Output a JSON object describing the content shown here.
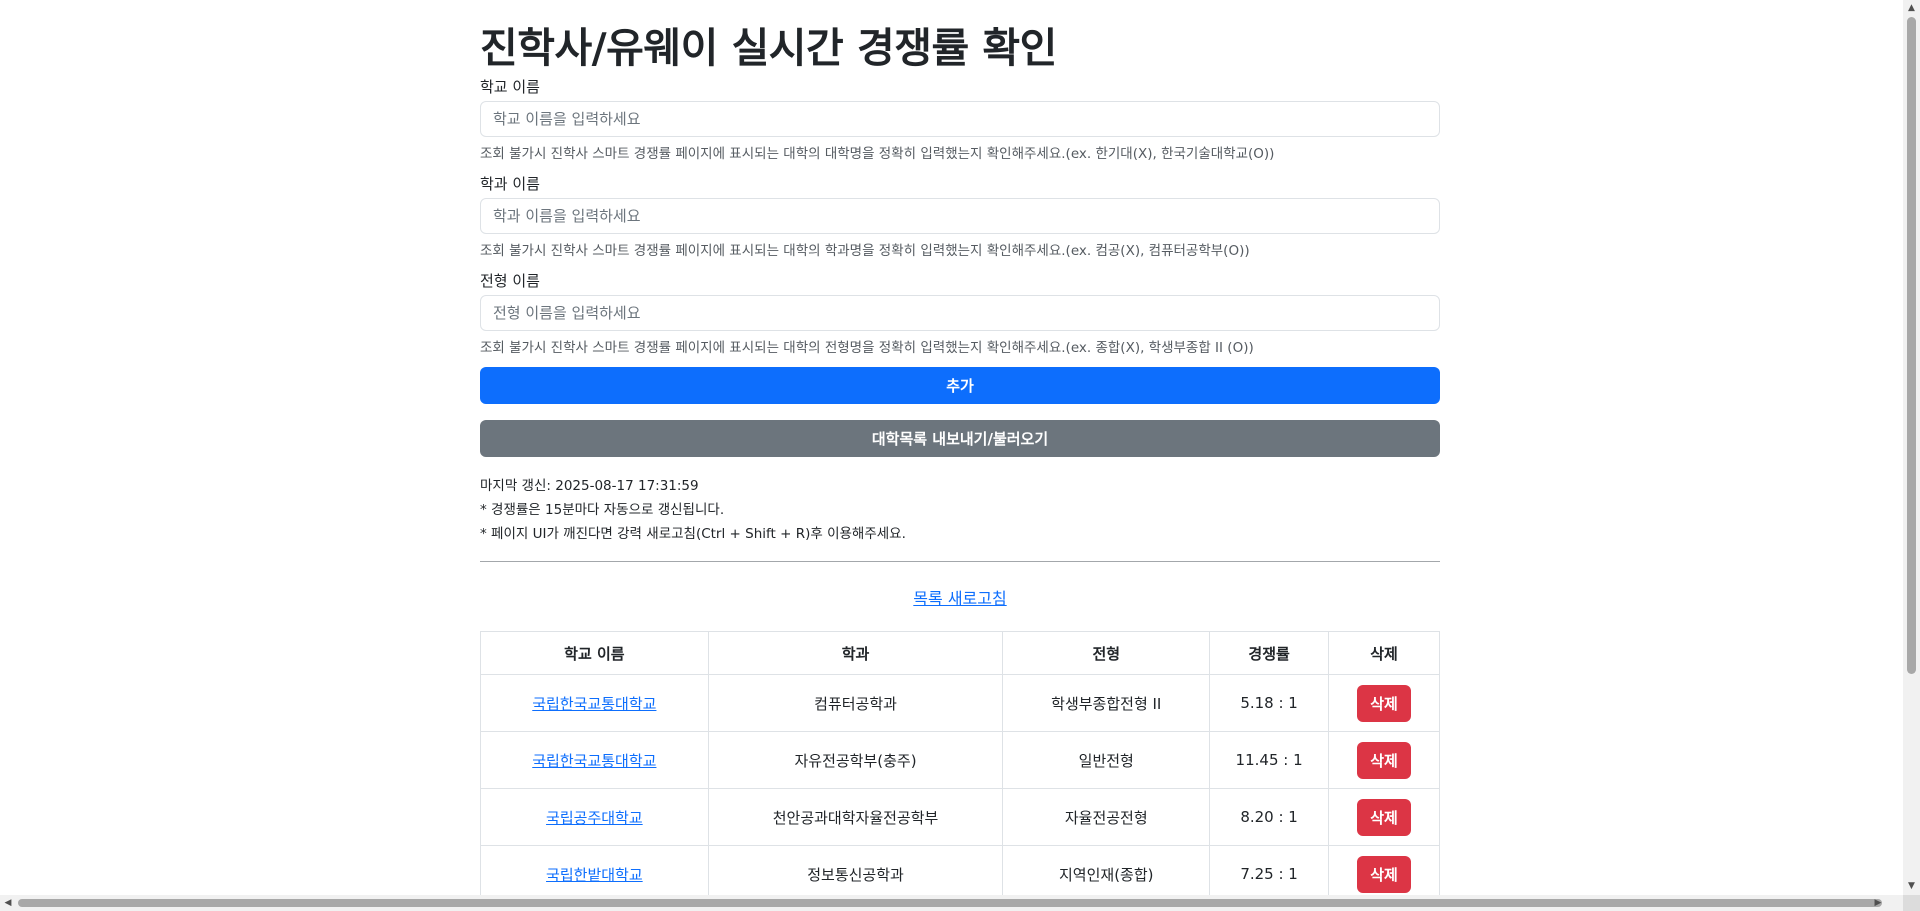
{
  "title": "진학사/유웨이 실시간 경쟁률 확인",
  "school": {
    "label": "학교 이름",
    "placeholder": "학교 이름을 입력하세요",
    "help": "조회 불가시 진학사 스마트 경쟁률 페이지에 표시되는 대학의 대학명을 정확히 입력했는지 확인해주세요.(ex. 한기대(X), 한국기술대학교(O))"
  },
  "department": {
    "label": "학과 이름",
    "placeholder": "학과 이름을 입력하세요",
    "help": "조회 불가시 진학사 스마트 경쟁률 페이지에 표시되는 대학의 학과명을 정확히 입력했는지 확인해주세요.(ex. 컴공(X), 컴퓨터공학부(O))"
  },
  "admission": {
    "label": "전형 이름",
    "placeholder": "전형 이름을 입력하세요",
    "help": "조회 불가시 진학사 스마트 경쟁률 페이지에 표시되는 대학의 전형명을 정확히 입력했는지 확인해주세요.(ex. 종합(X), 학생부종합 II (O))"
  },
  "buttons": {
    "add": "추가",
    "export_import": "대학목록 내보내기/불러오기"
  },
  "info": {
    "last_updated": "마지막 갱신: 2025-08-17 17:31:59",
    "note_interval": "* 경쟁률은 15분마다 자동으로 갱신됩니다.",
    "note_refresh": "* 페이지 UI가 깨진다면 강력 새로고침(Ctrl + Shift + R)후 이용해주세요."
  },
  "refresh_link": "목록 새로고침",
  "table": {
    "headers": [
      "학교 이름",
      "학과",
      "전형",
      "경쟁률",
      "삭제"
    ],
    "rows": [
      {
        "school": "국립한국교통대학교",
        "department": "컴퓨터공학과",
        "admission": "학생부종합전형 II",
        "ratio": "5.18 : 1",
        "delete": "삭제"
      },
      {
        "school": "국립한국교통대학교",
        "department": "자유전공학부(충주)",
        "admission": "일반전형",
        "ratio": "11.45 : 1",
        "delete": "삭제"
      },
      {
        "school": "국립공주대학교",
        "department": "천안공과대학자율전공학부",
        "admission": "자율전공전형",
        "ratio": "8.20 : 1",
        "delete": "삭제"
      },
      {
        "school": "국립한밭대학교",
        "department": "정보통신공학과",
        "admission": "지역인재(종합)",
        "ratio": "7.25 : 1",
        "delete": "삭제"
      }
    ]
  },
  "colors": {
    "primary": "#0d6efd",
    "secondary": "#6c757d",
    "danger": "#dc3545"
  }
}
